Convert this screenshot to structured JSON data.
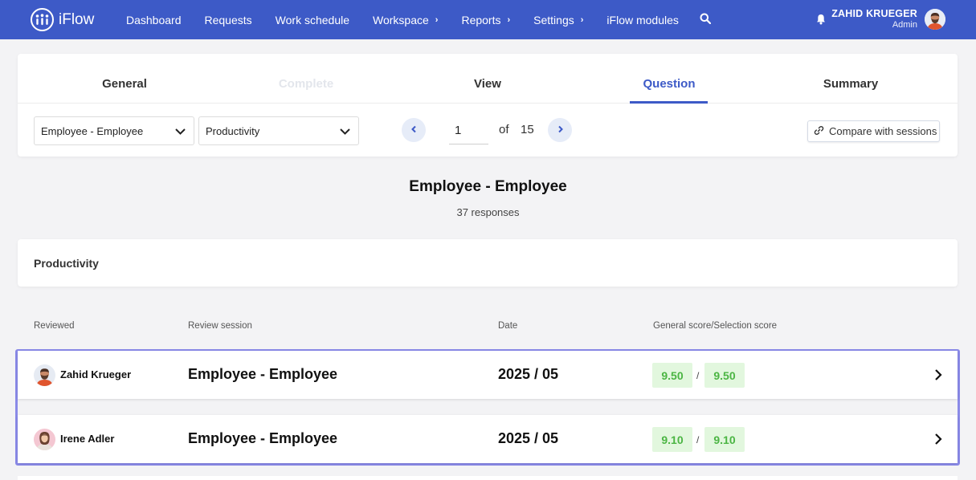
{
  "nav": {
    "brand": "iFlow",
    "items": [
      {
        "label": "Dashboard",
        "chevron": false
      },
      {
        "label": "Requests",
        "chevron": false
      },
      {
        "label": "Work schedule",
        "chevron": false
      },
      {
        "label": "Workspace",
        "chevron": true
      },
      {
        "label": "Reports",
        "chevron": true
      },
      {
        "label": "Settings",
        "chevron": true
      },
      {
        "label": "iFlow modules",
        "chevron": false
      }
    ],
    "user_name": "ZAHID KRUEGER",
    "user_role": "Admin",
    "color": "#3d5ac7"
  },
  "tabs": {
    "general": "General",
    "complete": "Complete",
    "view": "View",
    "question": "Question",
    "summary": "Summary",
    "active": "Question"
  },
  "filters": {
    "relationship": "Employee - Employee",
    "question": "Productivity",
    "page_current": "1",
    "page_of": "of",
    "page_total": "15",
    "compare_label": "Compare with sessions"
  },
  "section": {
    "title": "Employee - Employee",
    "responses": "37 responses"
  },
  "question_card": {
    "label": "Productivity"
  },
  "table": {
    "headers": {
      "reviewed": "Reviewed",
      "session": "Review session",
      "date": "Date",
      "score": "General score/Selection score"
    },
    "rows": [
      {
        "name": "Zahid Krueger",
        "session": "Employee - Employee",
        "date": "2025 / 05",
        "general_score": "9.50",
        "selection_score": "9.50",
        "separator": "/"
      },
      {
        "name": "Irene Adler",
        "session": "Employee - Employee",
        "date": "2025 / 05",
        "general_score": "9.10",
        "selection_score": "9.10",
        "separator": "/"
      }
    ]
  },
  "colors": {
    "accent": "#3d5ac7",
    "score_bg": "#e2f7de",
    "score_text": "#4bb543",
    "highlight_border": "#8a8ae8"
  }
}
